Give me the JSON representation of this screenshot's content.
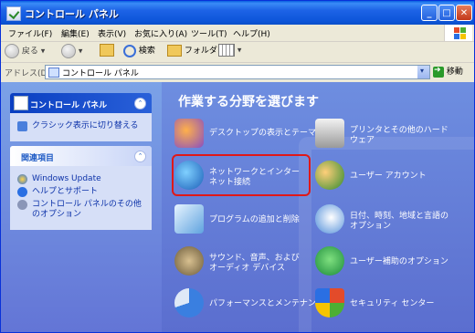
{
  "window": {
    "title": "コントロール パネル"
  },
  "titlebar_buttons": {
    "minimize": "_",
    "maximize": "□",
    "close": "✕"
  },
  "menu": [
    "ファイル(F)",
    "編集(E)",
    "表示(V)",
    "お気に入り(A)",
    "ツール(T)",
    "ヘルプ(H)"
  ],
  "toolbar": {
    "back": "戻る",
    "search": "検索",
    "folders": "フォルダ"
  },
  "address": {
    "label": "アドレス(D)",
    "value": "コントロール パネル",
    "go": "移動"
  },
  "left": {
    "panel1": {
      "title": "コントロール パネル",
      "link": "クラシック表示に切り替える"
    },
    "panel2": {
      "title": "関連項目",
      "links": [
        "Windows Update",
        "ヘルプとサポート",
        "コントロール パネルのその他のオプション"
      ]
    }
  },
  "main": {
    "title": "作業する分野を選びます",
    "categories": [
      {
        "label": "デスクトップの表示とテーマ",
        "icon": "desktop-theme-icon"
      },
      {
        "label": "プリンタとその他のハードウェア",
        "icon": "printer-icon"
      },
      {
        "label": "ネットワークとインターネット接続",
        "icon": "network-globe-icon"
      },
      {
        "label": "ユーザー アカウント",
        "icon": "user-accounts-icon"
      },
      {
        "label": "プログラムの追加と削除",
        "icon": "add-remove-programs-icon"
      },
      {
        "label": "日付、時刻、地域と言語のオプション",
        "icon": "date-time-icon"
      },
      {
        "label": "サウンド、音声、およびオーディオ デバイス",
        "icon": "speaker-icon"
      },
      {
        "label": "ユーザー補助のオプション",
        "icon": "accessibility-icon"
      },
      {
        "label": "パフォーマンスとメンテナンス",
        "icon": "performance-icon"
      },
      {
        "label": "セキュリティ センター",
        "icon": "security-shield-icon"
      }
    ]
  }
}
